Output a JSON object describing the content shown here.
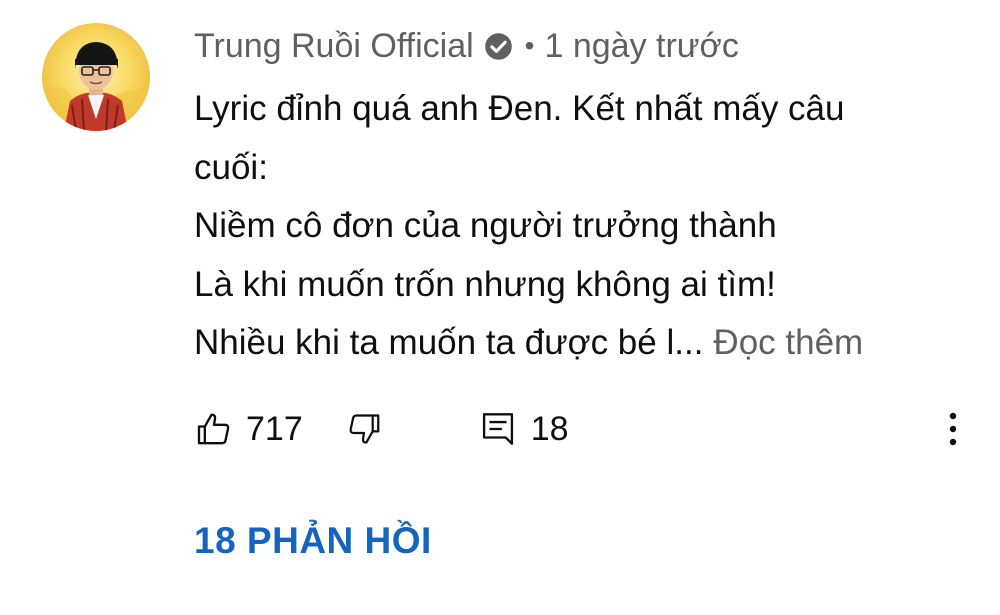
{
  "comment": {
    "author": "Trung Ruồi Official",
    "verified_icon": "verified-check-icon",
    "separator": "•",
    "timestamp": "1 ngày trước",
    "lines": [
      "Lyric đỉnh quá anh Đen. Kết nhất mấy câu",
      "cuối:",
      "Niềm cô đơn của người trưởng thành",
      "Là khi muốn trốn nhưng không ai tìm!",
      "Nhiều khi ta muốn ta được bé l..."
    ],
    "read_more": "Đọc thêm"
  },
  "actions": {
    "like_icon": "thumbs-up-icon",
    "like_count": "717",
    "dislike_icon": "thumbs-down-icon",
    "reply_icon": "reply-comment-icon",
    "reply_count": "18",
    "more_icon": "more-vertical-icon"
  },
  "replies": {
    "label": "18 PHẢN HỒI",
    "color": "#1565c0"
  }
}
